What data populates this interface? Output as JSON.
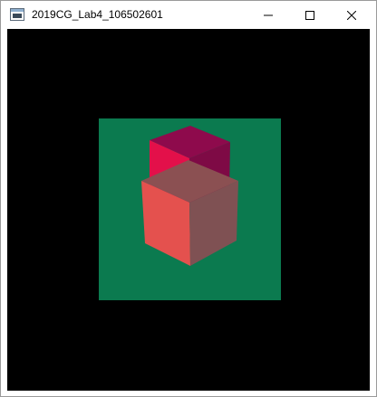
{
  "window": {
    "title": "2019CG_Lab4_106502601",
    "icons": {
      "app": "app-window-icon",
      "minimize": "minimize-icon",
      "maximize": "maximize-icon",
      "close": "close-icon"
    }
  },
  "scene": {
    "background_color": "#000000",
    "floor_color": "#0B7A4F",
    "cube_back": {
      "top_color": "#8E0A4C",
      "left_color": "#E3104A",
      "right_color": "#7E0A45"
    },
    "cube_front": {
      "top_color": "#8B5052",
      "left_color": "#E4514E",
      "right_color": "#7F5153"
    }
  }
}
